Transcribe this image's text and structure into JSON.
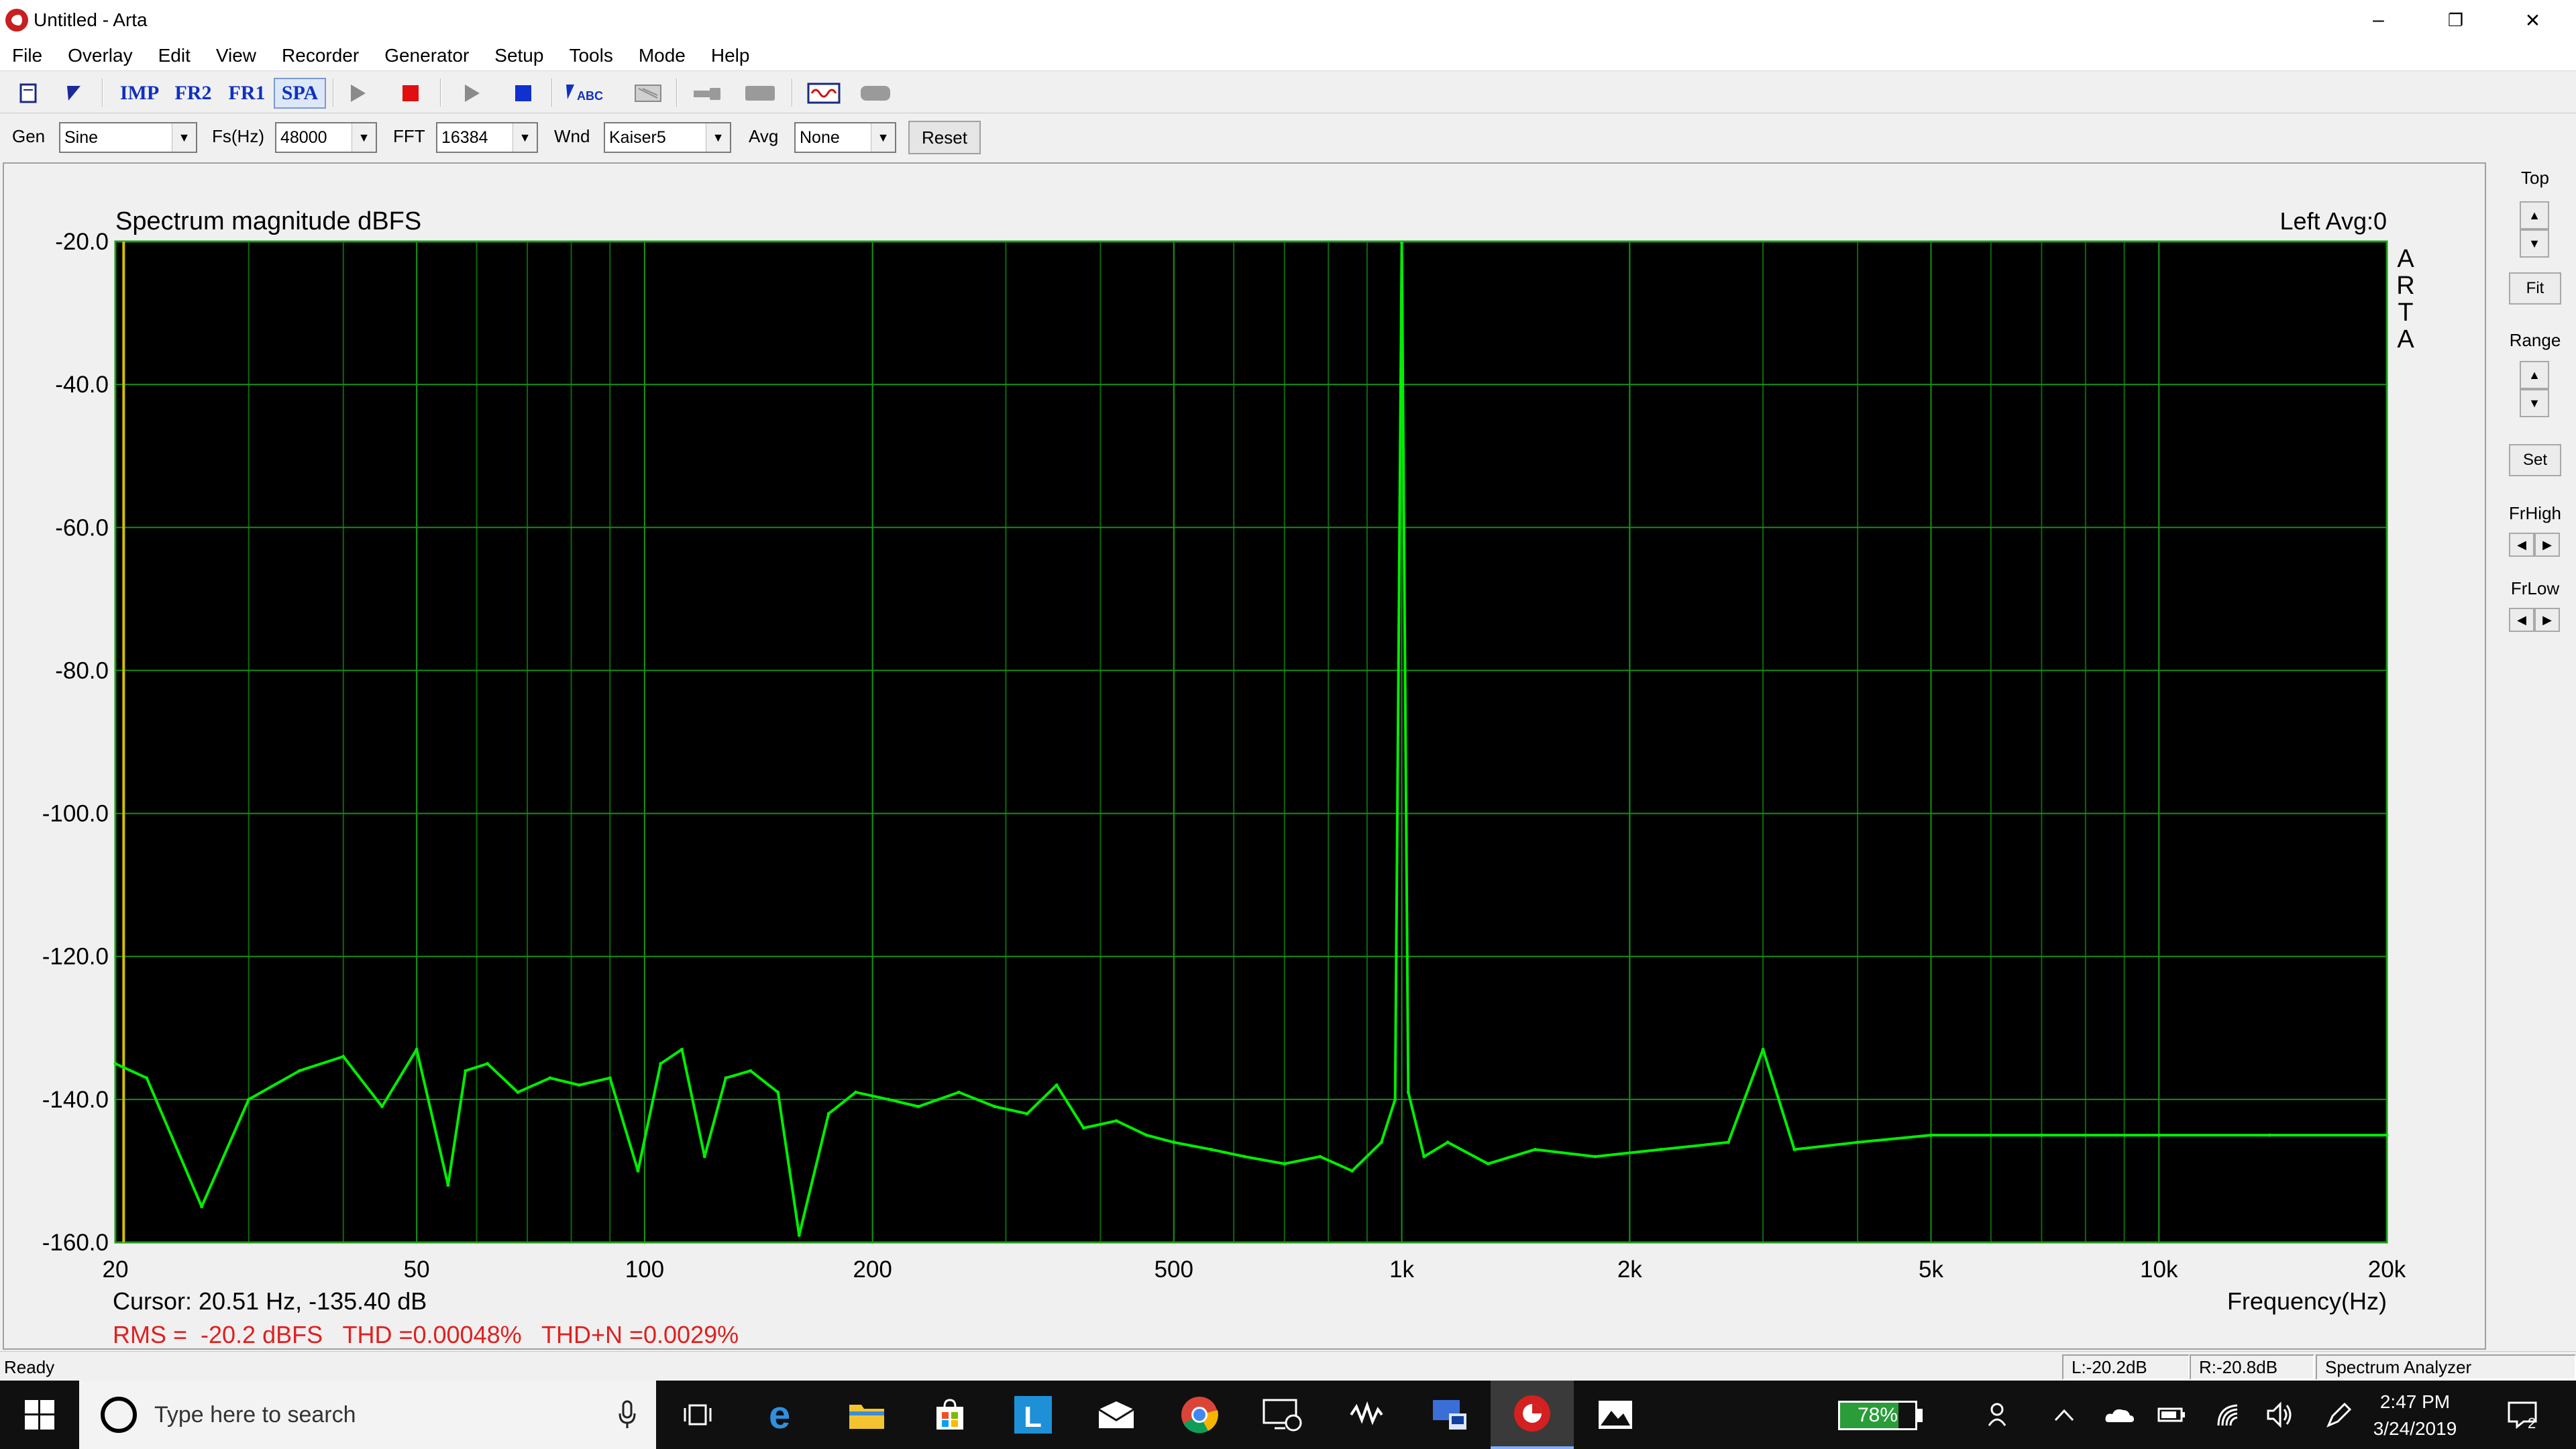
{
  "window": {
    "title": "Untitled - Arta",
    "min_glyph": "–",
    "restore_glyph": "❐",
    "close_glyph": "✕"
  },
  "menu": [
    "File",
    "Overlay",
    "Edit",
    "View",
    "Recorder",
    "Generator",
    "Setup",
    "Tools",
    "Mode",
    "Help"
  ],
  "toolbar": {
    "imp": "IMP",
    "fr2": "FR2",
    "fr1": "FR1",
    "spa": "SPA",
    "abc": "ABC"
  },
  "controls": {
    "gen_label": "Gen",
    "gen_value": "Sine",
    "fs_label": "Fs(Hz)",
    "fs_value": "48000",
    "fft_label": "FFT",
    "fft_value": "16384",
    "wnd_label": "Wnd",
    "wnd_value": "Kaiser5",
    "avg_label": "Avg",
    "avg_value": "None",
    "reset_label": "Reset"
  },
  "chart_data": {
    "type": "line",
    "title": "Spectrum magnitude dBFS",
    "channel_info": "Left  Avg:0",
    "watermark": [
      "A",
      "R",
      "T",
      "A"
    ],
    "xlabel": "Frequency(Hz)",
    "x_scale": "log",
    "xlim": [
      20,
      20000
    ],
    "ylim": [
      -160,
      -20
    ],
    "x_ticks": [
      20,
      50,
      100,
      200,
      500,
      1000,
      2000,
      5000,
      10000,
      20000
    ],
    "x_tick_labels": [
      "20",
      "50",
      "100",
      "200",
      "500",
      "1k",
      "2k",
      "5k",
      "10k",
      "20k"
    ],
    "y_ticks": [
      -20,
      -40,
      -60,
      -80,
      -100,
      -120,
      -140,
      -160
    ],
    "y_tick_labels": [
      "-20.0",
      "-40.0",
      "-60.0",
      "-80.0",
      "-100.0",
      "-120.0",
      "-140.0",
      "-160.0"
    ],
    "grid": true,
    "series": [
      {
        "color": "#00ee00",
        "x": [
          20,
          22,
          26,
          30,
          35,
          40,
          45,
          50,
          55,
          58,
          62,
          68,
          75,
          82,
          90,
          98,
          105,
          112,
          120,
          128,
          138,
          150,
          160,
          175,
          190,
          210,
          230,
          260,
          290,
          320,
          350,
          380,
          420,
          460,
          500,
          560,
          620,
          700,
          780,
          860,
          940,
          980,
          1000,
          1020,
          1070,
          1150,
          1300,
          1500,
          1800,
          2200,
          2700,
          3000,
          3300,
          4000,
          5000,
          7000,
          10000,
          14000,
          20000
        ],
        "y": [
          -135,
          -137,
          -155,
          -140,
          -136,
          -134,
          -141,
          -133,
          -152,
          -136,
          -135,
          -139,
          -137,
          -138,
          -137,
          -150,
          -135,
          -133,
          -148,
          -137,
          -136,
          -139,
          -159,
          -142,
          -139,
          -140,
          -141,
          -139,
          -141,
          -142,
          -138,
          -144,
          -143,
          -145,
          -146,
          -147,
          -148,
          -149,
          -148,
          -150,
          -146,
          -140,
          -20.2,
          -139,
          -148,
          -146,
          -149,
          -147,
          -148,
          -147,
          -146,
          -133,
          -147,
          -146,
          -145,
          -145,
          -145,
          -145,
          -145
        ]
      }
    ],
    "cursor_text": "Cursor: 20.51 Hz, -135.40 dB",
    "stats_text": "RMS =  -20.2 dBFS   THD =0.00048%   THD+N =0.0029%"
  },
  "right_panel": {
    "top_label": "Top",
    "fit_label": "Fit",
    "range_label": "Range",
    "set_label": "Set",
    "frhigh_label": "FrHigh",
    "frlow_label": "FrLow"
  },
  "status": {
    "ready": "Ready",
    "left_level": "L:-20.2dB",
    "right_level": "R:-20.8dB",
    "mode": "Spectrum Analyzer"
  },
  "taskbar": {
    "search_placeholder": "Type here to search",
    "battery": "78%",
    "battery_level": 0.78,
    "time": "2:47 PM",
    "date": "3/24/2019",
    "notifications": "2"
  }
}
